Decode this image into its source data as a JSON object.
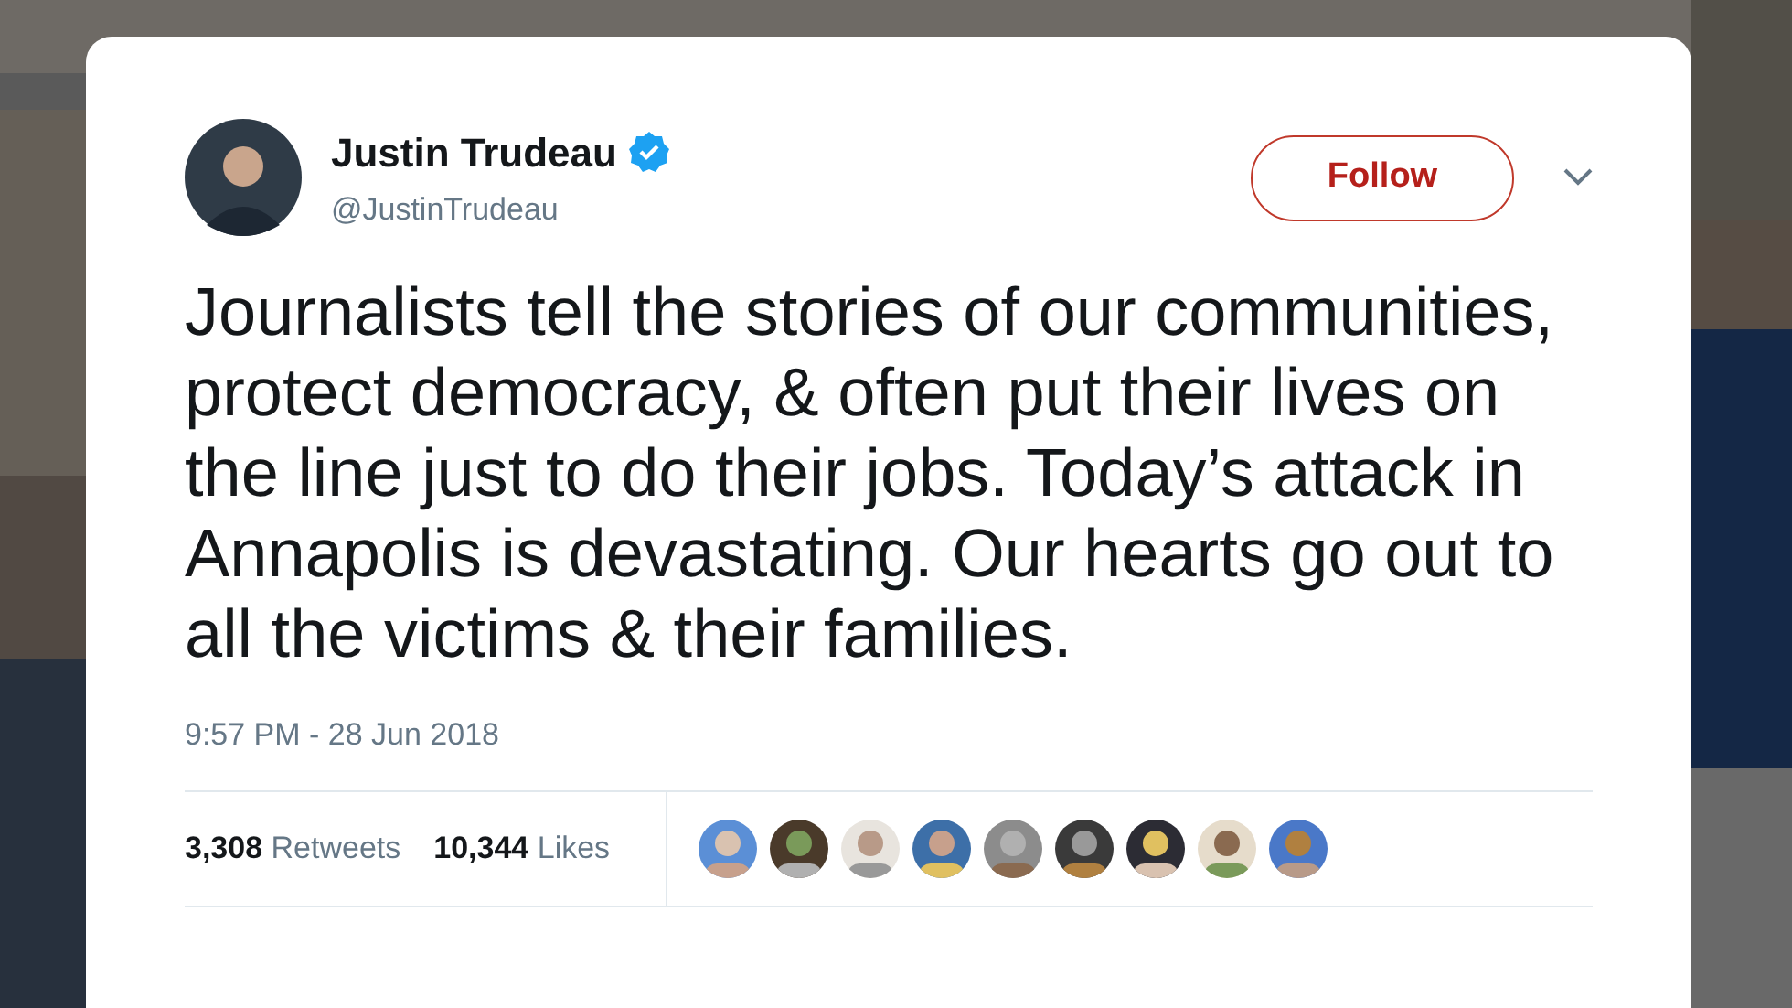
{
  "tweet": {
    "author": {
      "name": "Justin Trudeau",
      "verified": true,
      "handle": "@JustinTrudeau"
    },
    "follow_button": "Follow",
    "text": "Journalists tell the stories of our communities, protect democracy, & often put their lives on the line just to do their jobs. Today’s attack in Annapolis is devastating. Our hearts go out to all the victims & their families.",
    "timestamp": "9:57 PM - 28 Jun 2018",
    "stats": [
      {
        "count": "3,308",
        "label": "Retweets"
      },
      {
        "count": "10,344",
        "label": "Likes"
      }
    ]
  }
}
